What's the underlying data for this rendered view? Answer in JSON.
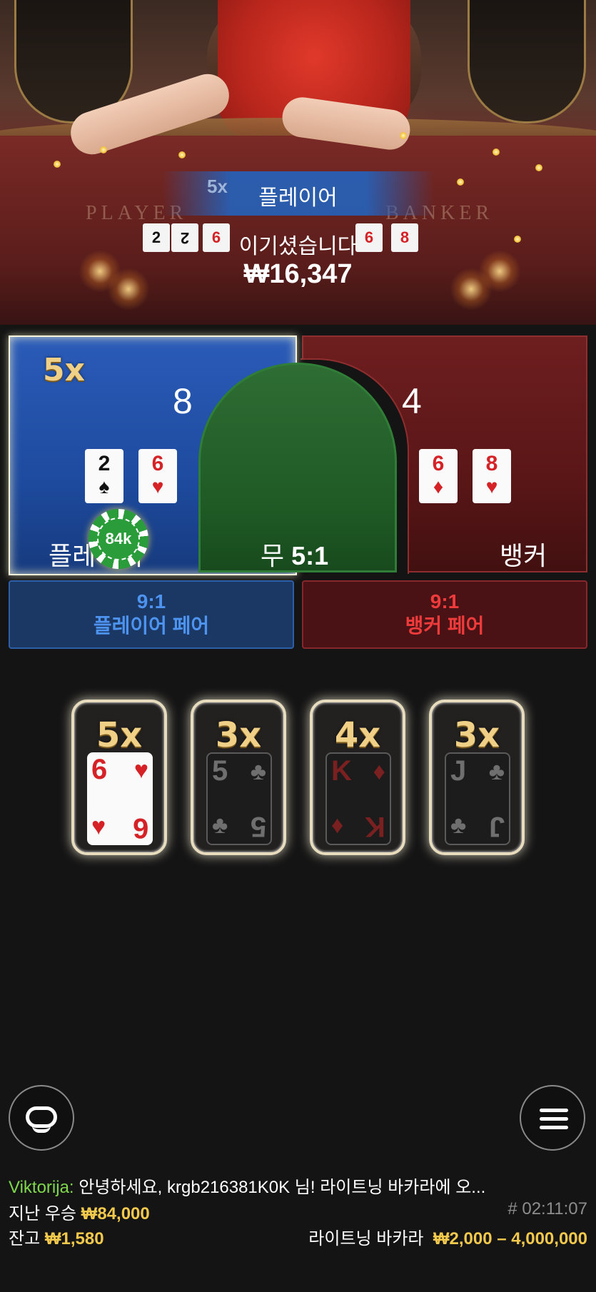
{
  "video": {
    "felt_player_text": "PLAYER",
    "felt_banker_text": "BANKER",
    "table_cards": [
      {
        "rank": "2",
        "suit": "♠",
        "color": "black"
      },
      {
        "rank": "2",
        "suit": "♠",
        "color": "black"
      },
      {
        "rank": "6",
        "suit": "♥",
        "color": "red"
      },
      {
        "rank": "6",
        "suit": "♦",
        "color": "red"
      },
      {
        "rank": "8",
        "suit": "♥",
        "color": "red"
      }
    ]
  },
  "win_banner": {
    "multiplier": "5x",
    "side": "플레이어",
    "message": "이기셨습니다",
    "amount": "₩16,347"
  },
  "bet_spots": {
    "player": {
      "multiplier": "5x",
      "score": "8",
      "label": "플레이어",
      "cards": [
        {
          "rank": "2",
          "suit": "♠",
          "color": "black"
        },
        {
          "rank": "6",
          "suit": "♥",
          "color": "red"
        }
      ],
      "chip": "84k"
    },
    "tie": {
      "label": "무",
      "odds": "5:1"
    },
    "banker": {
      "score": "4",
      "label": "뱅커",
      "cards": [
        {
          "rank": "6",
          "suit": "♦",
          "color": "red"
        },
        {
          "rank": "8",
          "suit": "♥",
          "color": "red"
        }
      ]
    },
    "player_pair": {
      "odds": "9:1",
      "label": "플레이어 페어"
    },
    "banker_pair": {
      "odds": "9:1",
      "label": "뱅커 페어"
    }
  },
  "lightning_cards": [
    {
      "multiplier": "5x",
      "rank": "6",
      "suit": "♥",
      "color": "red",
      "dealt": true
    },
    {
      "multiplier": "3x",
      "rank": "5",
      "suit": "♣",
      "color": "black",
      "dealt": false
    },
    {
      "multiplier": "4x",
      "rank": "K",
      "suit": "♦",
      "color": "red",
      "dealt": false
    },
    {
      "multiplier": "3x",
      "rank": "J",
      "suit": "♣",
      "color": "black",
      "dealt": false
    }
  ],
  "controls": {
    "chat_icon": "chat-bubble-icon",
    "menu_icon": "hamburger-menu-icon"
  },
  "chat": {
    "name": "Viktorija:",
    "message": "안녕하세요, krgb216381K0K 님! 라이트닝 바카라에 오..."
  },
  "footer": {
    "last_win_label": "지난 우승",
    "last_win_value": "₩84,000",
    "round_id": "# 02:11:07",
    "balance_label": "잔고",
    "balance_value": "₩1,580",
    "game_name": "라이트닝 바카라",
    "limits": "₩2,000 – 4,000,000"
  },
  "colors": {
    "player_blue": "#1e4b9f",
    "banker_red": "#5a1617",
    "tie_green": "#1f5a25",
    "gold": "#f2c94c",
    "chat_name_green": "#7fd84b"
  }
}
